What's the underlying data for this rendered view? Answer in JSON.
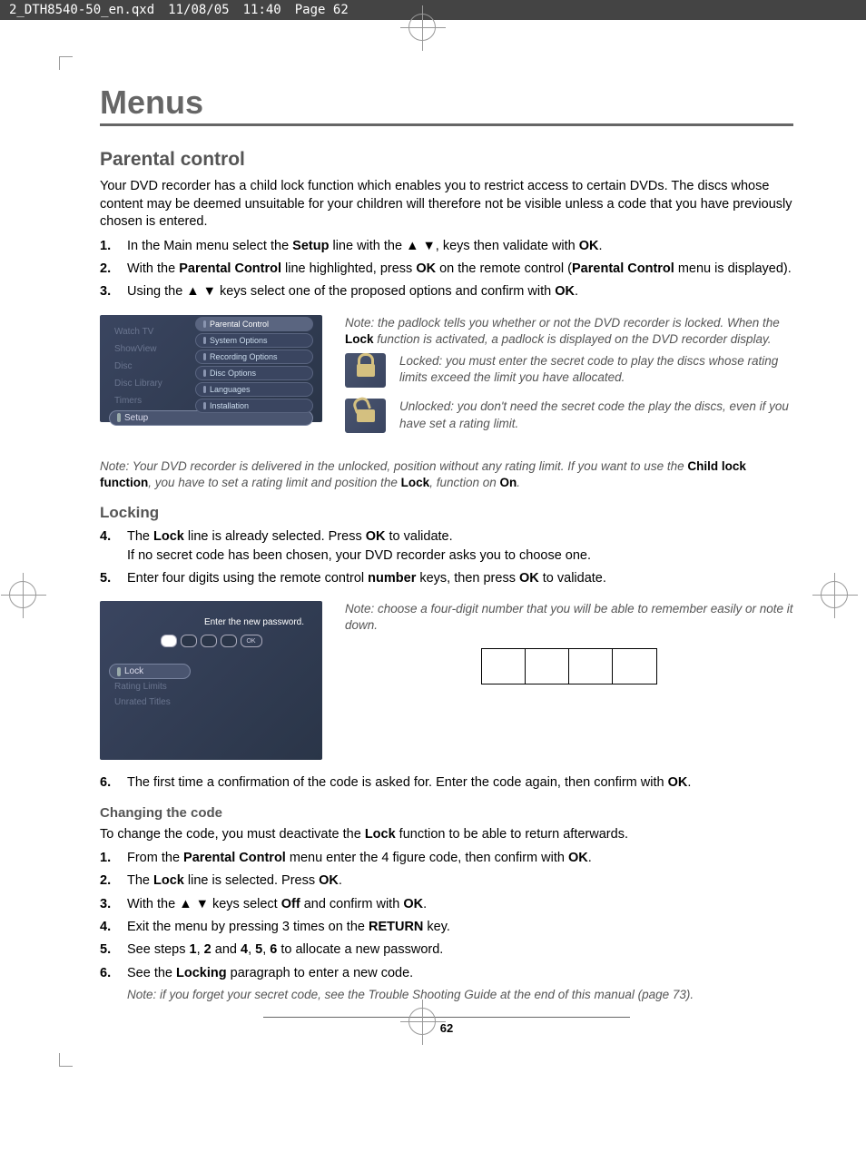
{
  "header": {
    "filename": "2_DTH8540-50_en.qxd",
    "date": "11/08/05",
    "time": "11:40",
    "page_label": "Page 62"
  },
  "title": "Menus",
  "section_title": "Parental control",
  "intro": "Your DVD recorder has a child lock function which enables you to restrict access to certain DVDs. The discs whose content may be deemed unsuitable for your children will therefore not be visible unless a code that you have previously chosen is entered.",
  "steps1": [
    {
      "num": "1.",
      "text_pre": "In the Main menu select the ",
      "b1": "Setup",
      "text_mid": " line with the ▲ ▼, keys then validate with ",
      "b2": "OK",
      "text_post": "."
    },
    {
      "num": "2.",
      "text_pre": "With the ",
      "b1": "Parental Control",
      "text_mid": " line highlighted, press ",
      "b2": "OK",
      "text_mid2": " on the remote control (",
      "b3": "Parental Control",
      "text_post": " menu is displayed)."
    },
    {
      "num": "3.",
      "text_pre": "Using the ▲ ▼ keys select one of the proposed options and confirm with ",
      "b1": "OK",
      "text_post": "."
    }
  ],
  "screenshot1": {
    "main_menu": [
      "Watch TV",
      "ShowView",
      "Disc",
      "Disc Library",
      "Timers",
      "Setup"
    ],
    "setup_submenu": [
      "Parental Control",
      "System Options",
      "Recording Options",
      "Disc Options",
      "Languages",
      "Installation"
    ]
  },
  "note1": {
    "text_pre": "Note: the padlock tells you whether or not the DVD recorder is locked. When the ",
    "b1": "Lock",
    "text_post": " function is activated, a padlock is displayed on the DVD recorder display."
  },
  "lock_descriptions": {
    "locked": "Locked: you must enter the secret code to play the discs whose rating limits exceed the limit you have allocated.",
    "unlocked": "Unlocked: you don't need the secret code the play the discs, even if you have set a rating limit."
  },
  "note2": {
    "text_pre": "Note: Your DVD recorder is delivered in the unlocked, position without any rating limit. If you want to use the ",
    "b1": "Child lock function",
    "text_mid": ", you have to set a rating limit and position the ",
    "b2": "Lock",
    "text_mid2": ", function on ",
    "b3": "On",
    "text_post": "."
  },
  "locking_title": "Locking",
  "steps2": [
    {
      "num": "4.",
      "text_pre": "The ",
      "b1": "Lock",
      "text_mid": " line is already selected. Press ",
      "b2": "OK",
      "text_post": " to validate.",
      "line2": "If no secret code has been chosen, your DVD recorder asks you to choose one."
    },
    {
      "num": "5.",
      "text_pre": "Enter four digits using the remote control ",
      "b1": "number",
      "text_mid": " keys, then press ",
      "b2": "OK",
      "text_post": " to validate."
    }
  ],
  "screenshot2": {
    "prompt": "Enter the new password.",
    "ok": "OK",
    "menu": [
      "Lock",
      "Rating Limits",
      "Unrated Titles"
    ]
  },
  "note3": "Note: choose a four-digit number that you will be able to remember easily or note it down.",
  "steps3": [
    {
      "num": "6.",
      "text_pre": "The first time a confirmation of the code is asked for. Enter the code again, then confirm with ",
      "b1": "OK",
      "text_post": "."
    }
  ],
  "changing_title": "Changing the code",
  "changing_intro_pre": "To change the code, you must deactivate the ",
  "changing_intro_b": "Lock",
  "changing_intro_post": " function to be able to return afterwards.",
  "steps4": [
    {
      "num": "1.",
      "text_pre": "From the ",
      "b1": "Parental Control",
      "text_mid": " menu enter the 4 figure code, then confirm with ",
      "b2": "OK",
      "text_post": "."
    },
    {
      "num": "2.",
      "text_pre": "The ",
      "b1": "Lock",
      "text_mid": " line is selected. Press ",
      "b2": "OK",
      "text_post": "."
    },
    {
      "num": "3.",
      "text_pre": "With the ▲ ▼ keys select ",
      "b1": "Off",
      "text_mid": " and confirm with ",
      "b2": "OK",
      "text_post": "."
    },
    {
      "num": "4.",
      "text_pre": "Exit the menu by pressing 3 times on the ",
      "b1": "RETURN",
      "text_post": " key."
    },
    {
      "num": "5.",
      "text_pre": "See steps ",
      "b1": "1",
      "text_mid": ", ",
      "b2": "2",
      "text_mid2": " and ",
      "b3": "4",
      "text_mid3": ", ",
      "b4": "5",
      "text_mid4": ", ",
      "b5": "6",
      "text_post": " to allocate a new password."
    },
    {
      "num": "6.",
      "text_pre": "See the ",
      "b1": "Locking",
      "text_post": " paragraph to enter a new code."
    }
  ],
  "note4": "Note: if you forget your secret code, see the Trouble Shooting Guide at the end of this manual (page 73).",
  "page_num": "62"
}
